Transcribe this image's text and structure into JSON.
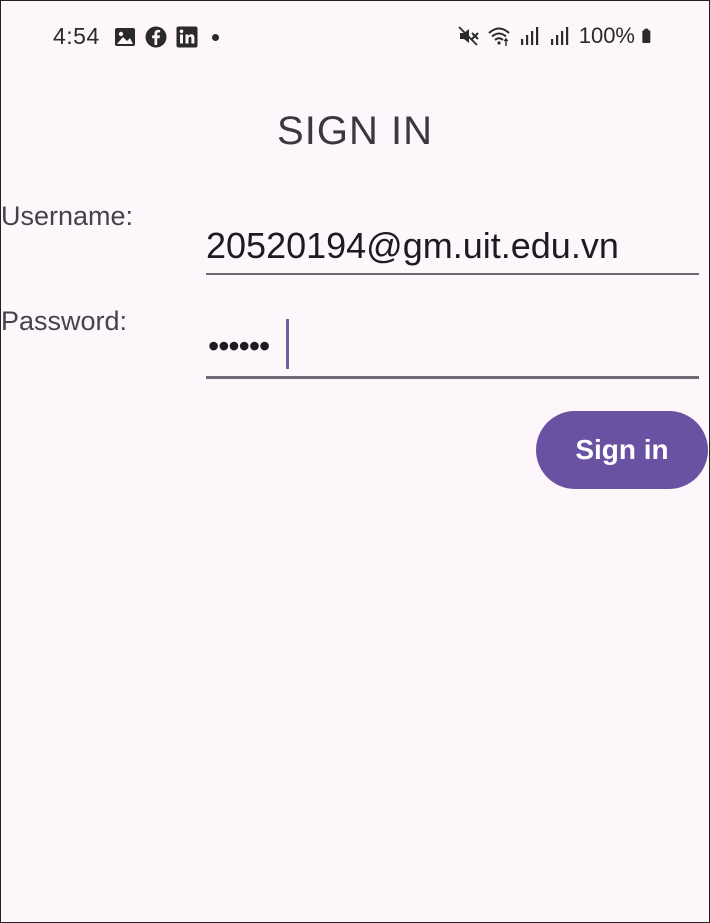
{
  "status_bar": {
    "time": "4:54",
    "notification_icons": [
      "gallery-icon",
      "facebook-icon",
      "linkedin-icon",
      "more-dot-icon"
    ],
    "system_icons": [
      "vibrate-muted-icon",
      "wifi-icon",
      "signal-icon",
      "signal-icon"
    ],
    "battery_percent": "100%"
  },
  "page": {
    "title": "SIGN IN"
  },
  "form": {
    "username_label": "Username:",
    "username_value": "20520194@gm.uit.edu.vn",
    "password_label": "Password:",
    "password_masked": "••••••",
    "submit_label": "Sign in"
  },
  "colors": {
    "background": "#fdf7fb",
    "accent": "#6a52a3",
    "underline": "#6f6a75"
  }
}
